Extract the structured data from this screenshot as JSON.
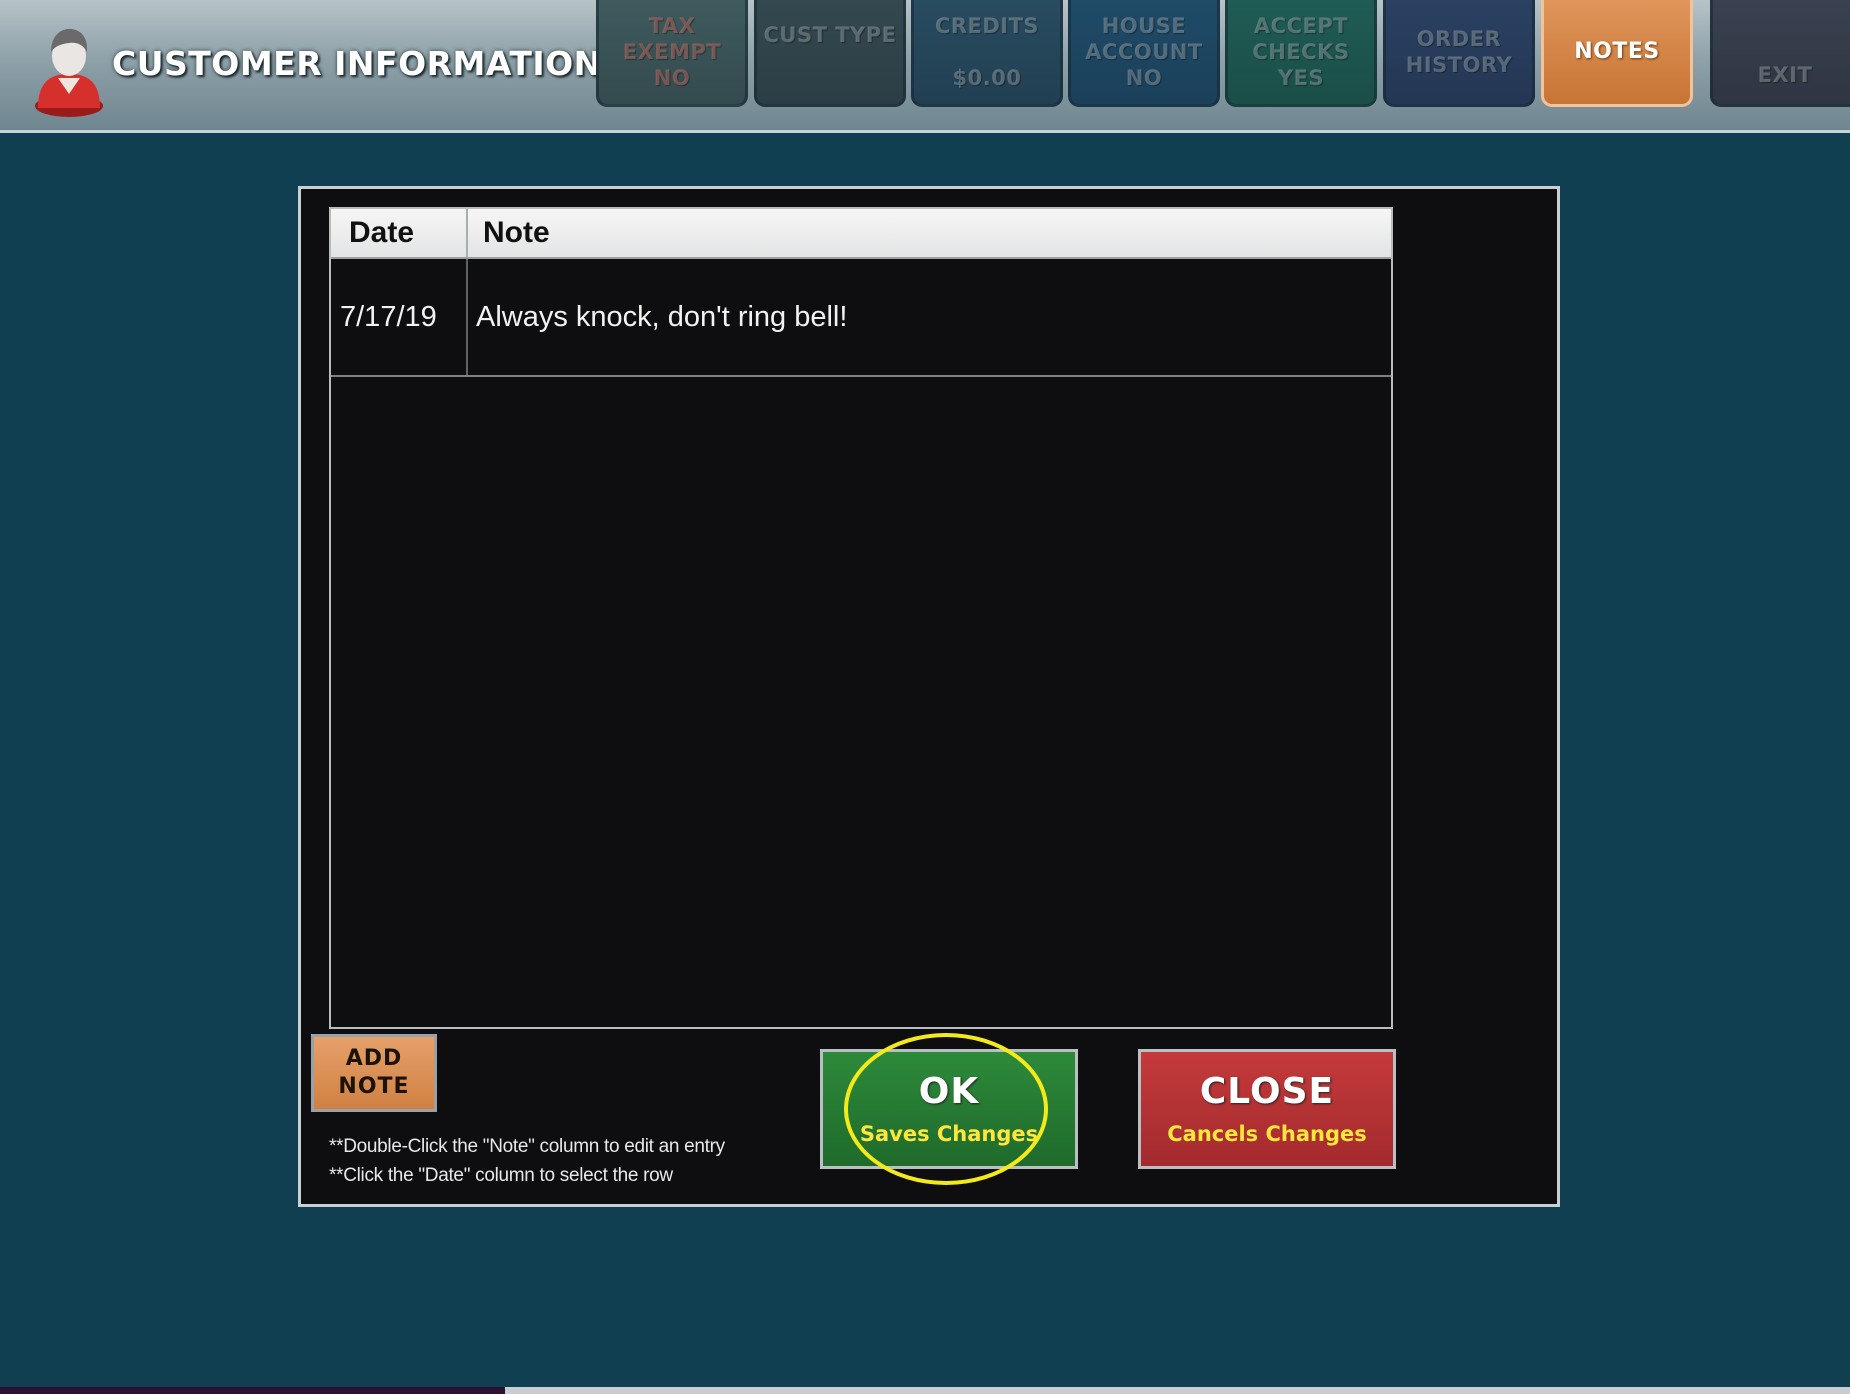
{
  "header": {
    "title": "CUSTOMER INFORMATION",
    "icon": "customer-avatar-icon",
    "nav": [
      {
        "id": "tax-exempt",
        "lines": [
          "TAX",
          "EXEMPT",
          "NO"
        ]
      },
      {
        "id": "cust-type",
        "lines": [
          "CUST TYPE"
        ]
      },
      {
        "id": "credits",
        "lines": [
          "CREDITS",
          "",
          "$0.00"
        ]
      },
      {
        "id": "house-account",
        "lines": [
          "HOUSE",
          "ACCOUNT",
          "NO"
        ]
      },
      {
        "id": "accept-checks",
        "lines": [
          "ACCEPT",
          "CHECKS",
          "YES"
        ]
      },
      {
        "id": "order-history",
        "lines": [
          "ORDER",
          "HISTORY"
        ]
      },
      {
        "id": "notes",
        "lines": [
          "NOTES"
        ],
        "active": true
      },
      {
        "id": "exit",
        "lines": [
          "EXIT"
        ]
      }
    ]
  },
  "notes_grid": {
    "columns": [
      "Date",
      "Note"
    ],
    "rows": [
      {
        "date": "7/17/19",
        "note": "Always knock, don't ring bell!"
      }
    ]
  },
  "actions": {
    "add_note": [
      "ADD",
      "NOTE"
    ],
    "ok": {
      "label": "OK",
      "sub": "Saves Changes"
    },
    "close": {
      "label": "CLOSE",
      "sub": "Cancels Changes"
    }
  },
  "hints": [
    "**Double-Click the \"Note\" column to edit an entry",
    "**Click the \"Date\" column to select the row"
  ],
  "colors": {
    "background": "#0f3f50",
    "notes_accent": "#d9894a",
    "ok": "#237330",
    "close": "#b3303a",
    "highlight": "#f4ea1a"
  }
}
